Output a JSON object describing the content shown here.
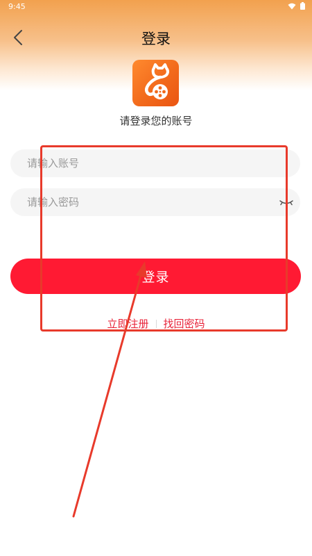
{
  "status_bar": {
    "time": "9:45",
    "icons": [
      "wifi-icon",
      "battery-icon"
    ]
  },
  "header": {
    "title": "登录",
    "back_icon": "back-arrow-icon"
  },
  "app_logo": {
    "icon": "cat-film-reel-logo"
  },
  "subtitle": "请登录您的账号",
  "form": {
    "account_placeholder": "请输入账号",
    "account_value": "",
    "password_placeholder": "请输入密码",
    "password_value": "",
    "password_toggle_icon": "eye-closed-icon"
  },
  "login_button": "登录",
  "links": {
    "register": "立即注册",
    "forgot_password": "找回密码"
  },
  "colors": {
    "header_gradient_top": "#f2a14e",
    "logo_orange": "#f26a1c",
    "primary_red": "#ff1a33",
    "link_red": "#e8243a",
    "annotation_red": "#e83a2b",
    "field_bg": "#f5f5f5"
  }
}
